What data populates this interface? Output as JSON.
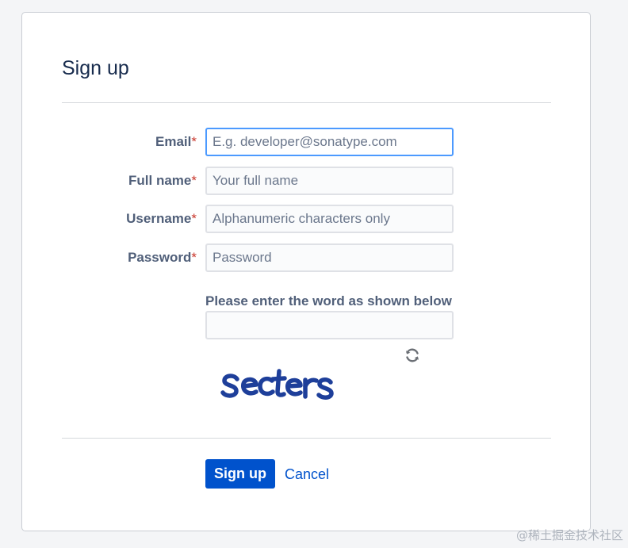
{
  "form": {
    "title": "Sign up",
    "fields": {
      "email": {
        "label": "Email",
        "required_mark": "*",
        "placeholder": "E.g. developer@sonatype.com",
        "value": ""
      },
      "full_name": {
        "label": "Full name",
        "required_mark": "*",
        "placeholder": "Your full name",
        "value": ""
      },
      "username": {
        "label": "Username",
        "required_mark": "*",
        "placeholder": "Alphanumeric characters only",
        "value": ""
      },
      "password": {
        "label": "Password",
        "required_mark": "*",
        "placeholder": "Password",
        "value": ""
      }
    },
    "captcha": {
      "prompt": "Please enter the word as shown below",
      "value": "",
      "image_text": "secters",
      "refresh_icon": "refresh-icon"
    },
    "actions": {
      "submit_label": "Sign up",
      "cancel_label": "Cancel"
    }
  },
  "watermark": "@稀土掘金技术社区",
  "colors": {
    "primary": "#0052cc",
    "required": "#c9372c",
    "focus_border": "#4c9aff",
    "label": "#505f79",
    "captcha_ink": "#1e3f9a"
  }
}
